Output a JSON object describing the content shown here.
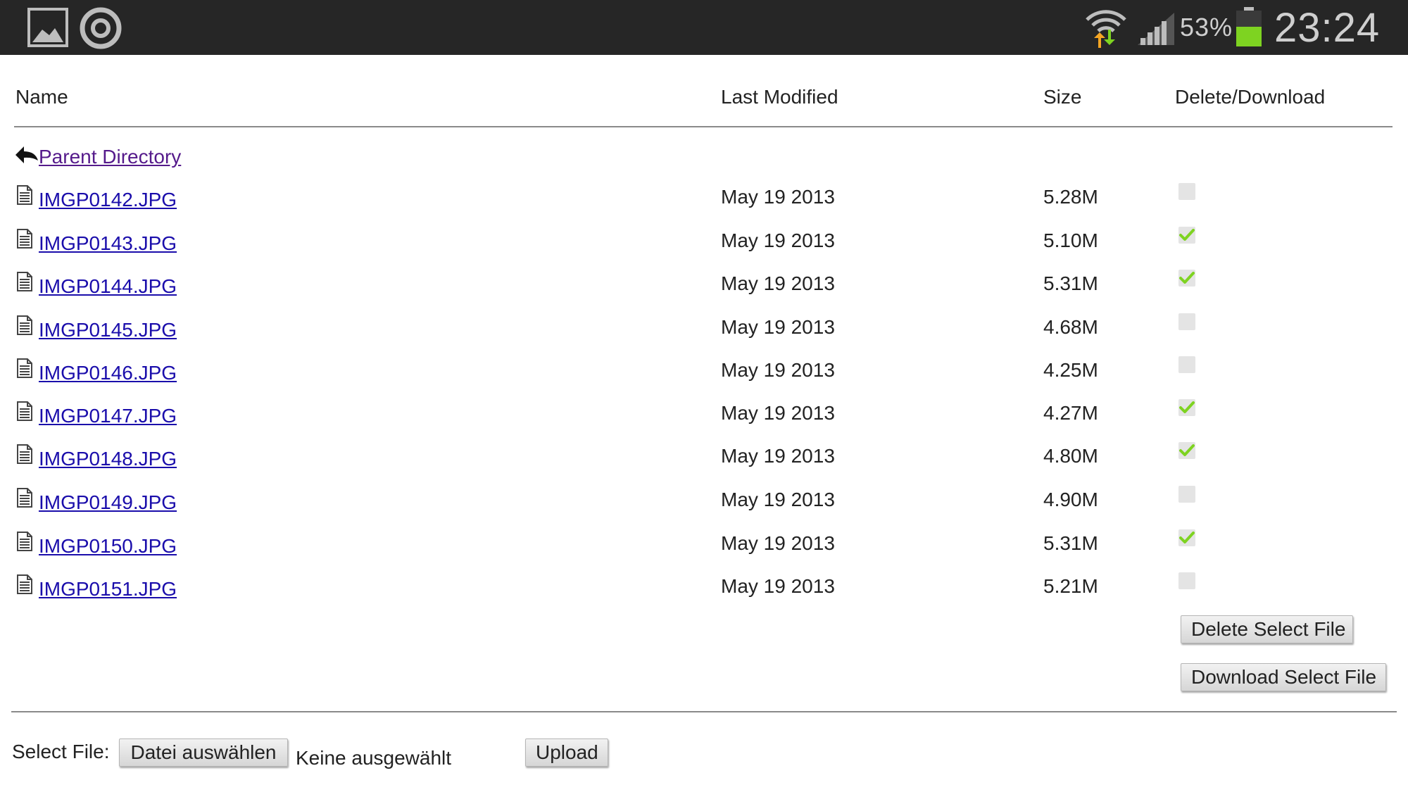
{
  "status_bar": {
    "battery_percent": "53%",
    "clock": "23:24",
    "icons": [
      "gallery-icon",
      "circle-app-icon",
      "wifi-icon",
      "signal-icon",
      "battery-icon"
    ],
    "battery_color": "#7ed321"
  },
  "table": {
    "headers": {
      "name": "Name",
      "last_modified": "Last Modified",
      "size": "Size",
      "action": "Delete/Download"
    },
    "parent_directory": "Parent Directory",
    "files": [
      {
        "name": "IMGP0142.JPG",
        "date": "May 19 2013",
        "size": "5.28M",
        "checked": false
      },
      {
        "name": "IMGP0143.JPG",
        "date": "May 19 2013",
        "size": "5.10M",
        "checked": true
      },
      {
        "name": "IMGP0144.JPG",
        "date": "May 19 2013",
        "size": "5.31M",
        "checked": true
      },
      {
        "name": "IMGP0145.JPG",
        "date": "May 19 2013",
        "size": "4.68M",
        "checked": false
      },
      {
        "name": "IMGP0146.JPG",
        "date": "May 19 2013",
        "size": "4.25M",
        "checked": false
      },
      {
        "name": "IMGP0147.JPG",
        "date": "May 19 2013",
        "size": "4.27M",
        "checked": true
      },
      {
        "name": "IMGP0148.JPG",
        "date": "May 19 2013",
        "size": "4.80M",
        "checked": true
      },
      {
        "name": "IMGP0149.JPG",
        "date": "May 19 2013",
        "size": "4.90M",
        "checked": false
      },
      {
        "name": "IMGP0150.JPG",
        "date": "May 19 2013",
        "size": "5.31M",
        "checked": true
      },
      {
        "name": "IMGP0151.JPG",
        "date": "May 19 2013",
        "size": "5.21M",
        "checked": false
      }
    ]
  },
  "actions": {
    "delete_label": "Delete Select File",
    "download_label": "Download Select File"
  },
  "upload": {
    "select_label": "Select File:",
    "choose_button": "Datei auswählen",
    "no_file_text": "Keine ausgewählt",
    "upload_button": "Upload"
  },
  "colors": {
    "link": "#1a0dab",
    "visited_link": "#551a8b",
    "check": "#7ed321",
    "status_bar_bg": "#262626"
  }
}
